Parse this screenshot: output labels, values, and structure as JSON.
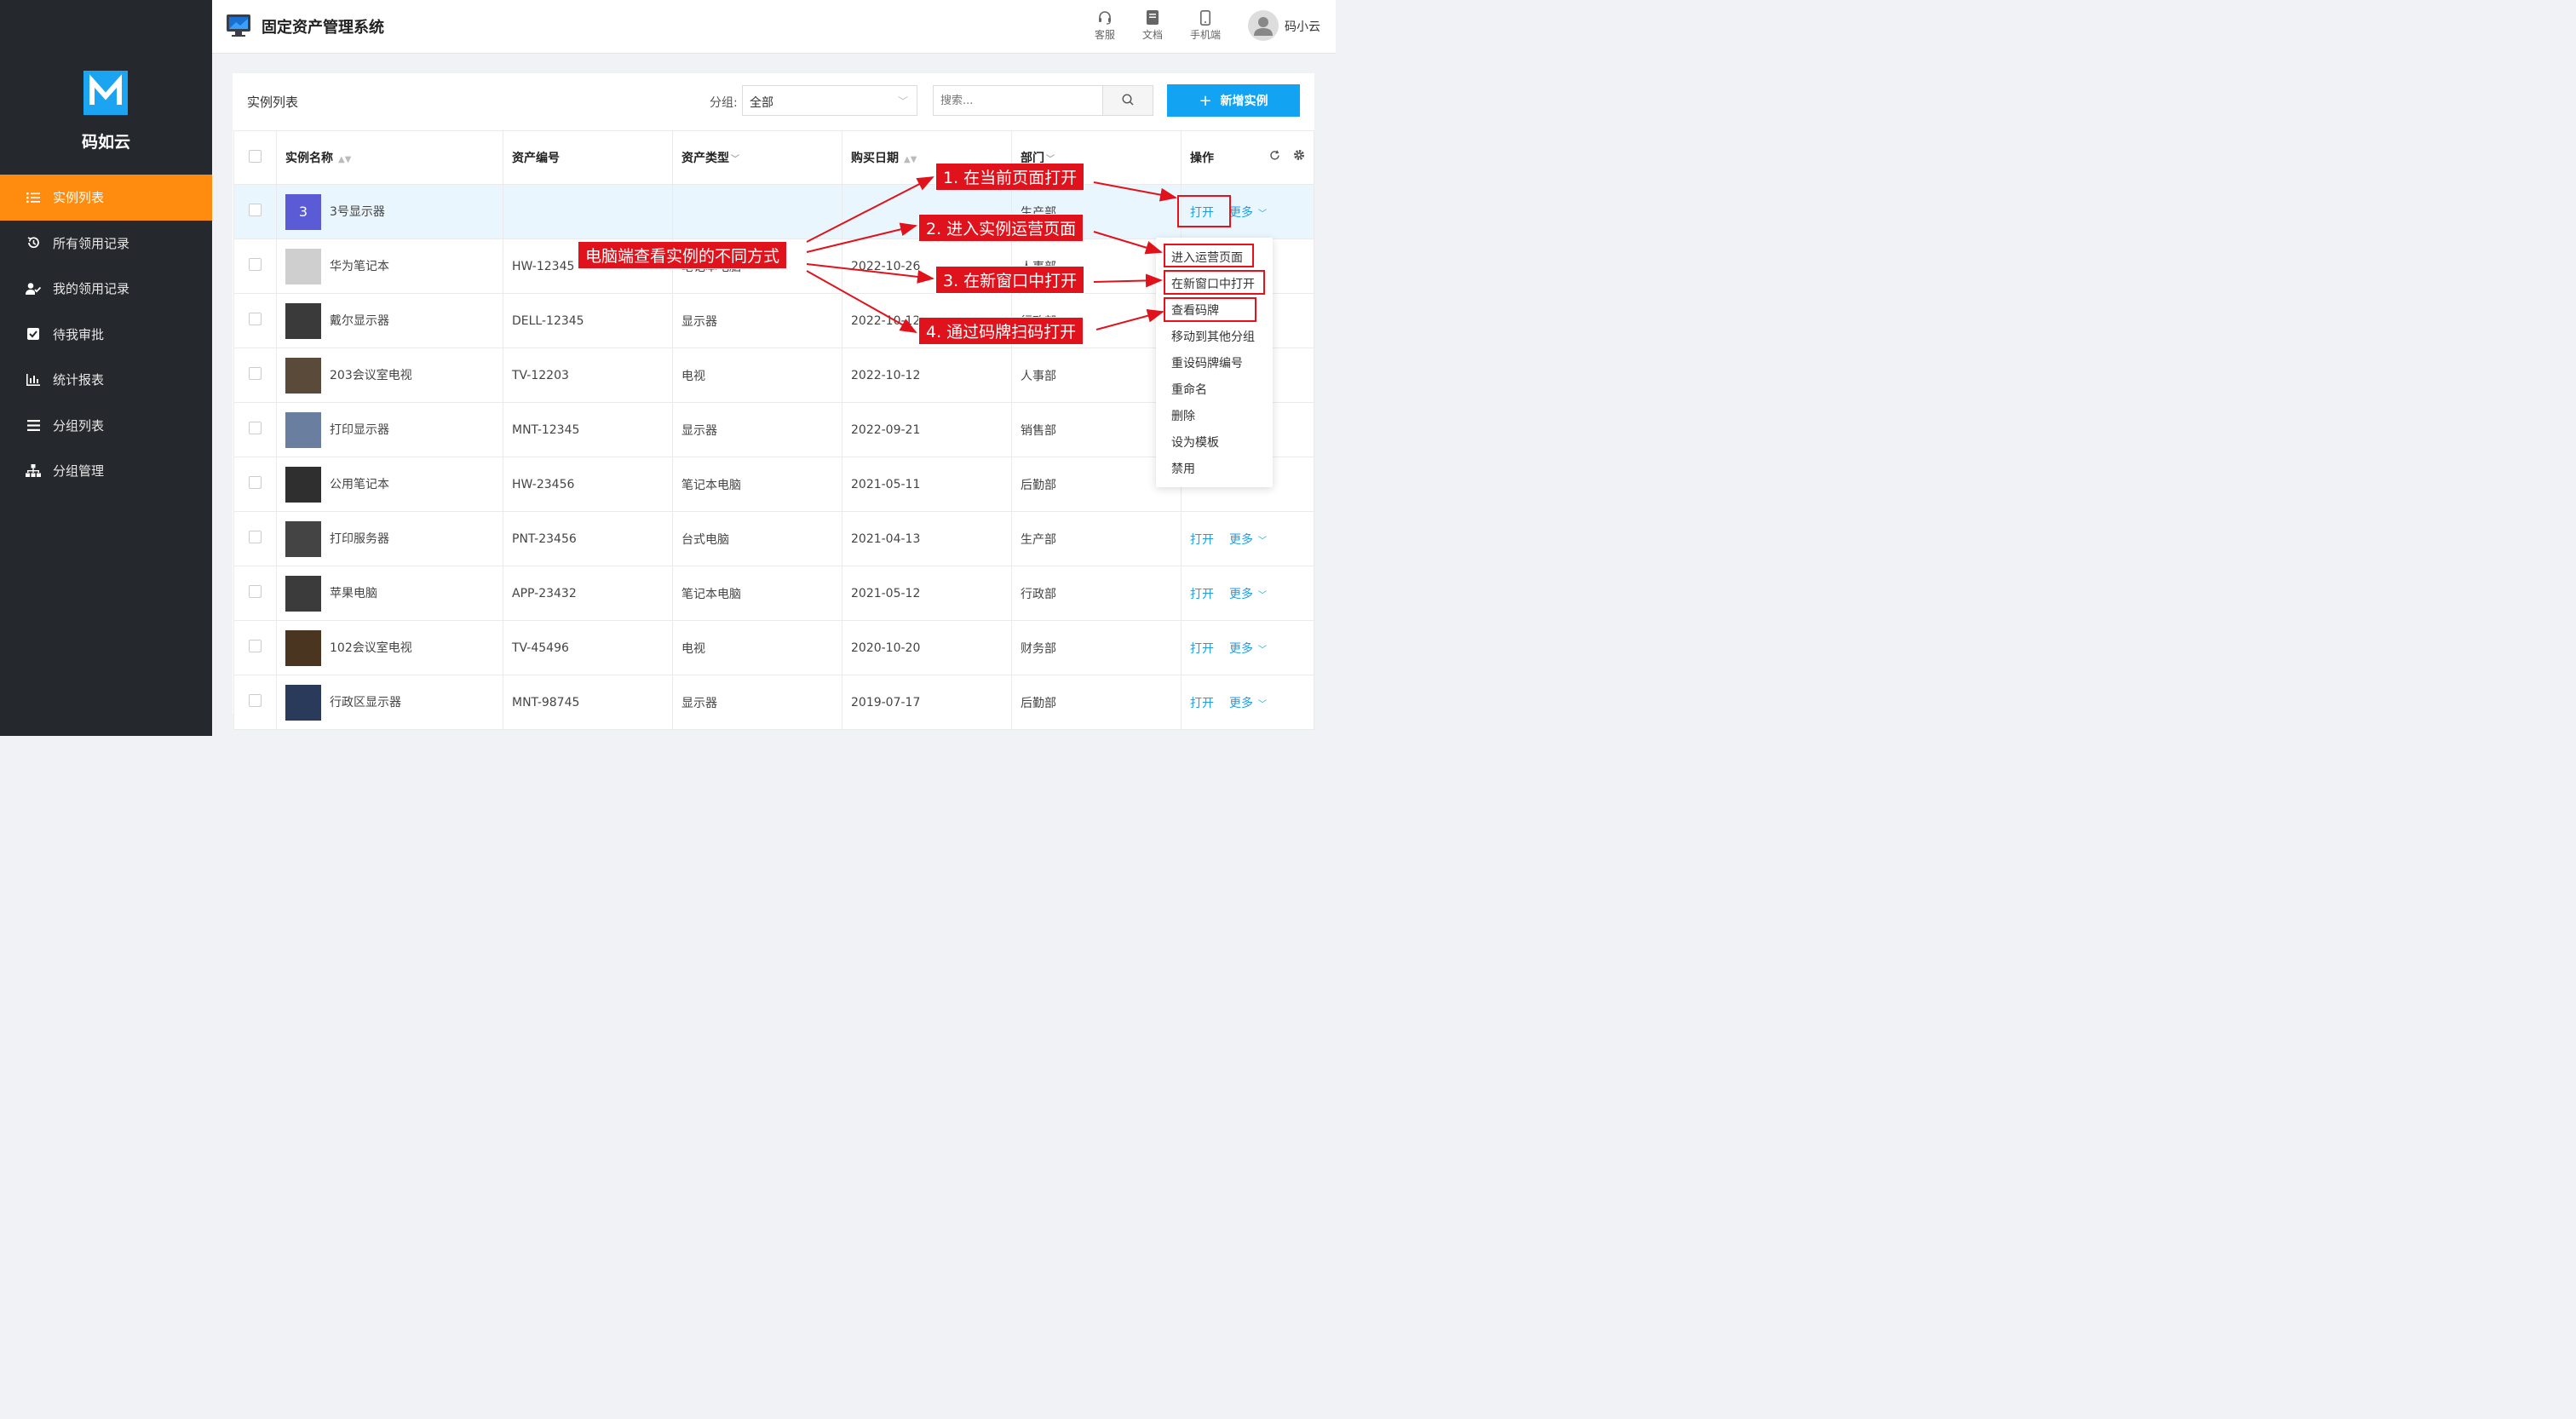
{
  "brand": {
    "name": "码如云"
  },
  "sidebar": {
    "items": [
      {
        "label": "实例列表",
        "icon": "list-icon",
        "active": true
      },
      {
        "label": "所有领用记录",
        "icon": "history-icon"
      },
      {
        "label": "我的领用记录",
        "icon": "user-check-icon"
      },
      {
        "label": "待我审批",
        "icon": "checkbox-icon"
      },
      {
        "label": "统计报表",
        "icon": "bar-chart-icon"
      },
      {
        "label": "分组列表",
        "icon": "menu-icon"
      },
      {
        "label": "分组管理",
        "icon": "sitemap-icon"
      }
    ]
  },
  "header": {
    "title": "固定资产管理系统",
    "tools": [
      {
        "label": "客服",
        "icon": "headset-icon"
      },
      {
        "label": "文档",
        "icon": "document-icon"
      },
      {
        "label": "手机端",
        "icon": "mobile-icon"
      }
    ],
    "user": "码小云"
  },
  "toolbar": {
    "title": "实例列表",
    "group_label": "分组:",
    "group_value": "全部",
    "search_placeholder": "搜索...",
    "add_label": "新增实例"
  },
  "table": {
    "columns": [
      "实例名称",
      "资产编号",
      "资产类型",
      "购买日期",
      "部门",
      "操作"
    ],
    "rows": [
      {
        "name": "3号显示器",
        "code": "",
        "type": "",
        "date": "",
        "dept": "生产部",
        "thumb": "3",
        "highlight": true
      },
      {
        "name": "华为笔记本",
        "code": "HW-12345",
        "type": "笔记本电脑",
        "date": "2022-10-26",
        "dept": "人事部"
      },
      {
        "name": "戴尔显示器",
        "code": "DELL-12345",
        "type": "显示器",
        "date": "2022-10-12",
        "dept": "行政部"
      },
      {
        "name": "203会议室电视",
        "code": "TV-12203",
        "type": "电视",
        "date": "2022-10-12",
        "dept": "人事部"
      },
      {
        "name": "打印显示器",
        "code": "MNT-12345",
        "type": "显示器",
        "date": "2022-09-21",
        "dept": "销售部"
      },
      {
        "name": "公用笔记本",
        "code": "HW-23456",
        "type": "笔记本电脑",
        "date": "2021-05-11",
        "dept": "后勤部"
      },
      {
        "name": "打印服务器",
        "code": "PNT-23456",
        "type": "台式电脑",
        "date": "2021-04-13",
        "dept": "生产部"
      },
      {
        "name": "苹果电脑",
        "code": "APP-23432",
        "type": "笔记本电脑",
        "date": "2021-05-12",
        "dept": "行政部"
      },
      {
        "name": "102会议室电视",
        "code": "TV-45496",
        "type": "电视",
        "date": "2020-10-20",
        "dept": "财务部"
      },
      {
        "name": "行政区显示器",
        "code": "MNT-98745",
        "type": "显示器",
        "date": "2019-07-17",
        "dept": "后勤部"
      }
    ],
    "open_label": "打开",
    "more_label": "更多"
  },
  "dropdown": {
    "items": [
      "进入运营页面",
      "在新窗口中打开",
      "查看码牌",
      "移动到其他分组",
      "重设码牌编号",
      "重命名",
      "删除",
      "设为模板",
      "禁用"
    ]
  },
  "annotations": {
    "main": "电脑端查看实例的不同方式",
    "a1": "1. 在当前页面打开",
    "a2": "2. 进入实例运营页面",
    "a3": "3. 在新窗口中打开",
    "a4": "4. 通过码牌扫码打开"
  },
  "colors": {
    "sidebar_bg": "#25282d",
    "active_nav": "#ff8c0f",
    "accent": "#12a4f3",
    "annotation_red": "#e0121c"
  }
}
